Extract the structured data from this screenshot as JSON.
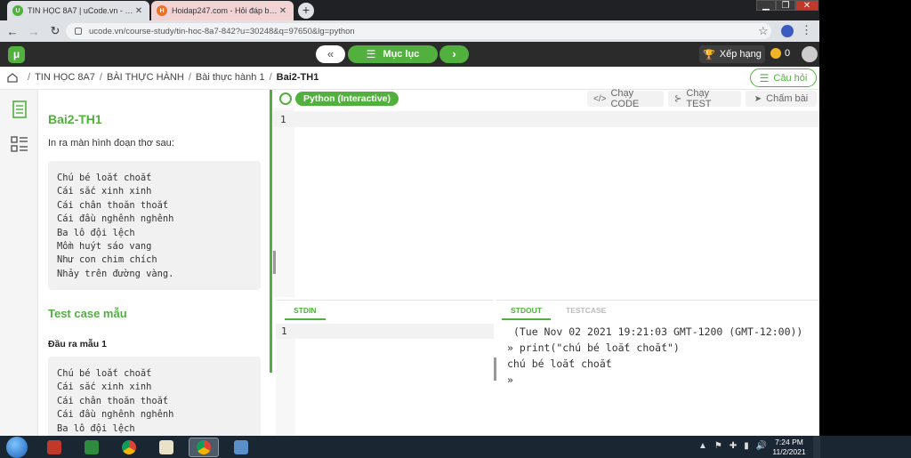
{
  "browser": {
    "tabs": [
      {
        "title": "TIN HỌC 8A7 | uCode.vn - Lập trì...",
        "favicon": "U",
        "active": true
      },
      {
        "title": "Hoidap247.com - Hỏi đáp bài tập...",
        "favicon": "H",
        "active": false
      }
    ],
    "url": "ucode.vn/course-study/tin-hoc-8a7-842?u=30248&q=97650&lg=python"
  },
  "appbar": {
    "logo": "μ",
    "prev_label": "«",
    "menu_label": "Mục lục",
    "next_label": "›",
    "rank_label": "Xếp hạng",
    "coins": "0"
  },
  "breadcrumb": {
    "items": [
      "TIN HỌC 8A7",
      "BÀI THỰC HÀNH",
      "Bài thực hành 1"
    ],
    "current": "Bai2-TH1"
  },
  "ask_label": "Câu hỏi",
  "problem": {
    "title": "Bai2-TH1",
    "description": "In ra màn hình đoạn thơ sau:",
    "poem": [
      "Chú bé loắt choắt",
      "Cái sắc xinh xinh",
      "Cái chân thoăn thoắt",
      "Cái đầu nghênh nghênh",
      "Ba lô đội lệch",
      "Mồm huýt sáo vang",
      "Như con chim chích",
      "Nhảy trên đường vàng."
    ],
    "testcase_heading": "Test case mẫu",
    "output_label": "Đầu ra mẫu 1",
    "sample_output": [
      "Chú bé loắt choắt",
      "Cái sắc xinh xinh",
      "Cái chân thoăn thoắt",
      "Cái đầu nghênh nghênh",
      "Ba lô đội lệch"
    ]
  },
  "editor": {
    "language": "Python (Interactive)",
    "run_code_label": "Chạy CODE",
    "run_test_label": "Chạy TEST",
    "grade_label": "Chấm bài",
    "line_number": "1"
  },
  "stdin": {
    "tab_label": "STDIN",
    "line_number": "1"
  },
  "stdout": {
    "tab_label": "STDOUT",
    "testcase_tab_label": "TESTCASE",
    "lines": [
      " (Tue Nov 02 2021 19:21:03 GMT-1200 (GMT-12:00))",
      "» print(\"chú bé loắt choắt\")",
      "chú bé loắt choắt",
      "»"
    ]
  },
  "taskbar": {
    "time": "7:24 PM",
    "date": "11/2/2021"
  },
  "colors": {
    "accent": "#52b03f",
    "header": "#2b2b2b"
  }
}
